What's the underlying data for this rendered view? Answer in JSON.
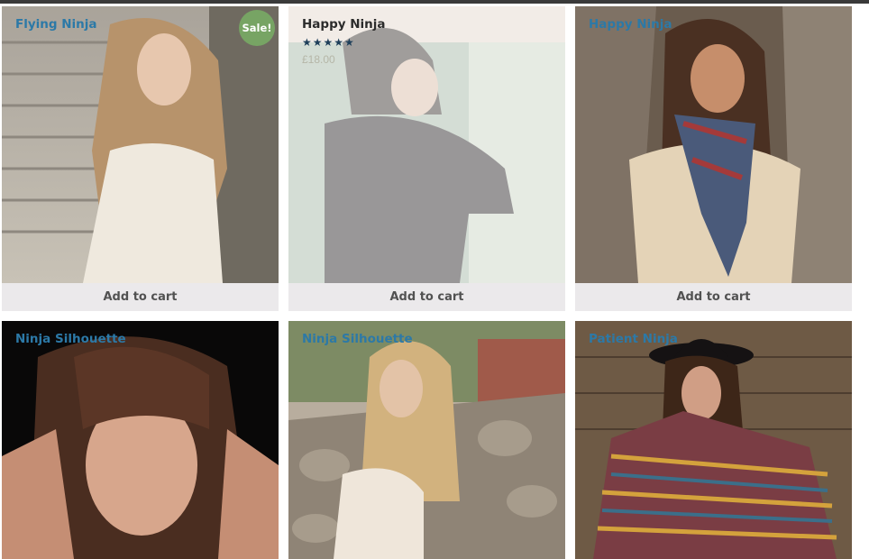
{
  "products": [
    {
      "title": "Flying Ninja",
      "sale_badge": "Sale!",
      "cart_label": "Add to cart"
    },
    {
      "title": "Happy Ninja",
      "rating_stars": "★★★★★",
      "rating": 5,
      "price": "£18.00",
      "cart_label": "Add to cart"
    },
    {
      "title": "Happy Ninja",
      "cart_label": "Add to cart"
    },
    {
      "title": "Ninja Silhouette"
    },
    {
      "title": "Ninja Silhouette"
    },
    {
      "title": "Patient Ninja"
    }
  ],
  "colors": {
    "title_link": "#2c79a7",
    "sale_badge": "#77a464",
    "cart_button_bg": "#ebe9eb",
    "star": "#1e3f5a"
  }
}
